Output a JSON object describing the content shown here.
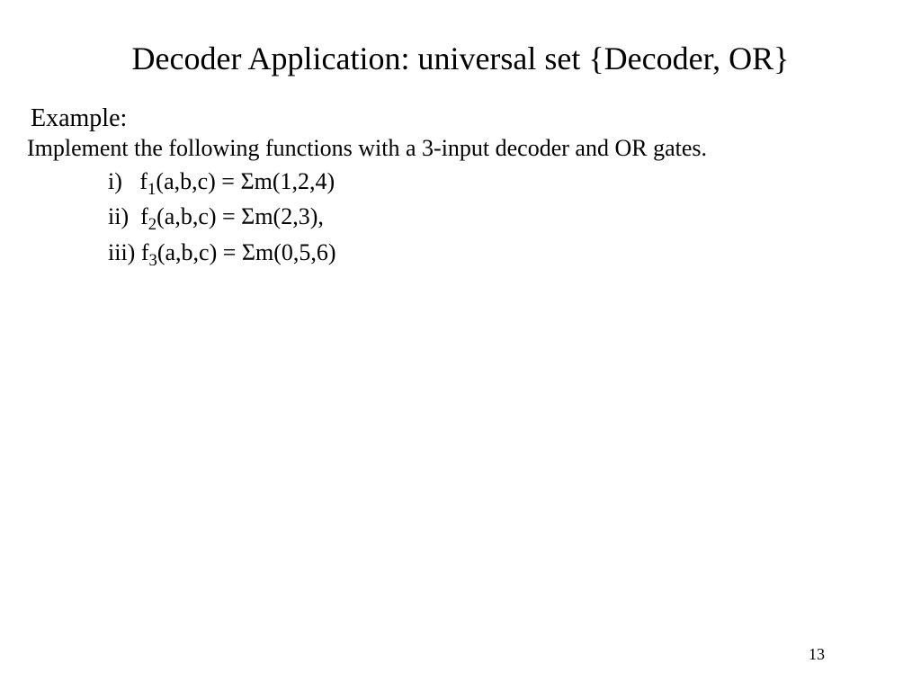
{
  "title": "Decoder Application: universal set {Decoder, OR}",
  "example_label": "Example:",
  "instruction": "Implement the following functions with a 3-input decoder and OR gates.",
  "eq": {
    "i_prefix": "i)   f",
    "i_sub": "1",
    "i_rest": "(a,b,c) = Σm(1,2,4)",
    "ii_prefix": "ii)  f",
    "ii_sub": "2",
    "ii_rest": "(a,b,c) = Σm(2,3),",
    "iii_prefix": "iii) f",
    "iii_sub": "3",
    "iii_rest": "(a,b,c) = Σm(0,5,6)"
  },
  "page_number": "13"
}
